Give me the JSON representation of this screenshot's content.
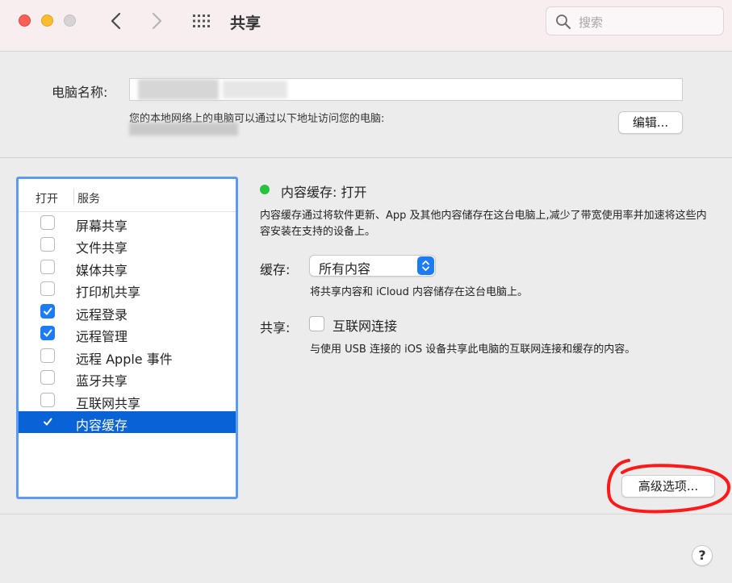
{
  "window": {
    "title": "共享"
  },
  "search": {
    "placeholder": "搜索"
  },
  "computer_name": {
    "label": "电脑名称:",
    "address_text": "您的本地网络上的电脑可以通过以下地址访问您的电脑:",
    "edit_label": "编辑..."
  },
  "service_list": {
    "header_on": "打开",
    "header_service": "服务",
    "items": [
      {
        "label": "屏幕共享",
        "checked": false
      },
      {
        "label": "文件共享",
        "checked": false
      },
      {
        "label": "媒体共享",
        "checked": false
      },
      {
        "label": "打印机共享",
        "checked": false
      },
      {
        "label": "远程登录",
        "checked": true
      },
      {
        "label": "远程管理",
        "checked": true
      },
      {
        "label": "远程 Apple 事件",
        "checked": false
      },
      {
        "label": "蓝牙共享",
        "checked": false
      },
      {
        "label": "互联网共享",
        "checked": false
      },
      {
        "label": "内容缓存",
        "checked": true,
        "selected": true
      }
    ]
  },
  "detail": {
    "status": "内容缓存: 打开",
    "description": "内容缓存通过将软件更新、App 及其他内容储存在这台电脑上,减少了带宽使用率并加速将这些内容安装在支持的设备上。",
    "cache_label": "缓存:",
    "cache_value": "所有内容",
    "cache_note": "将共享内容和 iCloud 内容储存在这台电脑上。",
    "share_label": "共享:",
    "share_option": "互联网连接",
    "share_checked": false,
    "share_note": "与使用 USB 连接的 iOS 设备共享此电脑的互联网连接和缓存的内容。"
  },
  "advanced_label": "高级选项...",
  "help_label": "?",
  "colors": {
    "accent": "#1b7cf5",
    "selection": "#0a63d6",
    "status_on": "#29c23f",
    "annotation": "#ff1a1a"
  }
}
